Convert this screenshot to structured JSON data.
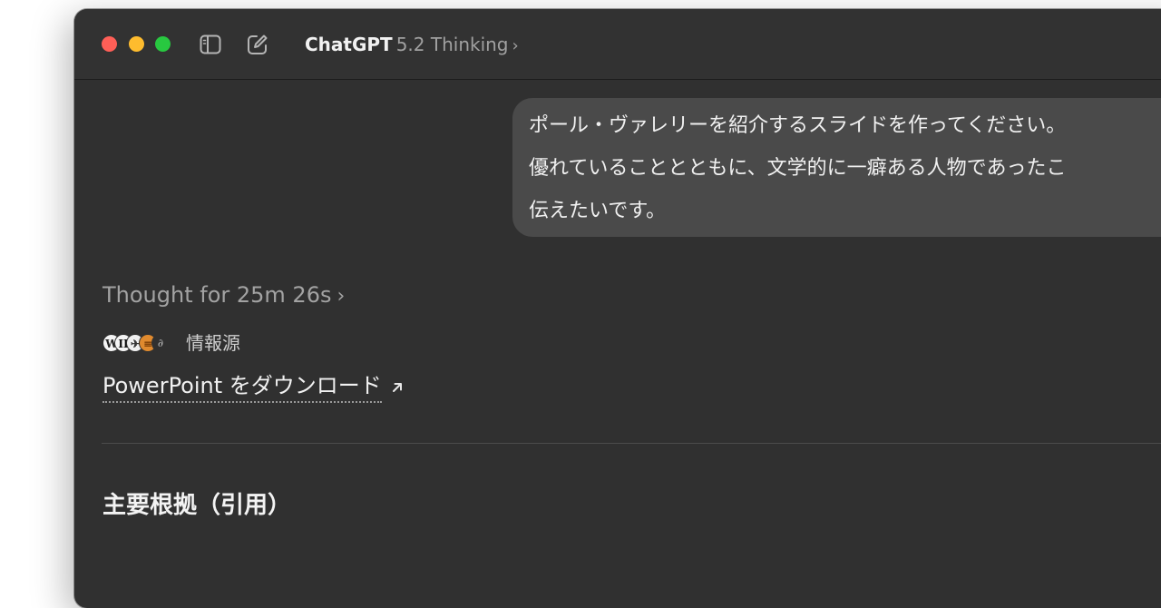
{
  "window": {
    "app_name": "ChatGPT",
    "model_name": "5.2 Thinking",
    "model_chevron": "›"
  },
  "icons": {
    "sidebar_toggle": "sidebar-toggle-icon",
    "new_chat": "compose-icon"
  },
  "user_message": {
    "lines": [
      "ポール・ヴァレリーを紹介するスライドを作ってください。",
      "優れていることとともに、文学的に一癖ある人物であったこ",
      "伝えたいです。"
    ]
  },
  "assistant": {
    "thought_label": "Thought for 25m 26s",
    "thought_chevron": "›",
    "sources_label": "情報源",
    "source_icons": [
      {
        "name": "wikipedia-icon",
        "glyph": "W"
      },
      {
        "name": "source-icon-2",
        "glyph": "II"
      },
      {
        "name": "source-icon-3",
        "glyph": "✈"
      },
      {
        "name": "source-icon-4",
        "glyph": "≡"
      },
      {
        "name": "source-icon-5",
        "glyph": "∂"
      }
    ],
    "download_label": "PowerPoint をダウンロード",
    "section_heading": "主要根拠（引用）"
  },
  "colors": {
    "window_bg": "#303030",
    "bubble_bg": "#4a4a4a",
    "close": "#ff5f57",
    "minimize": "#febc2e",
    "zoom": "#28c840"
  }
}
